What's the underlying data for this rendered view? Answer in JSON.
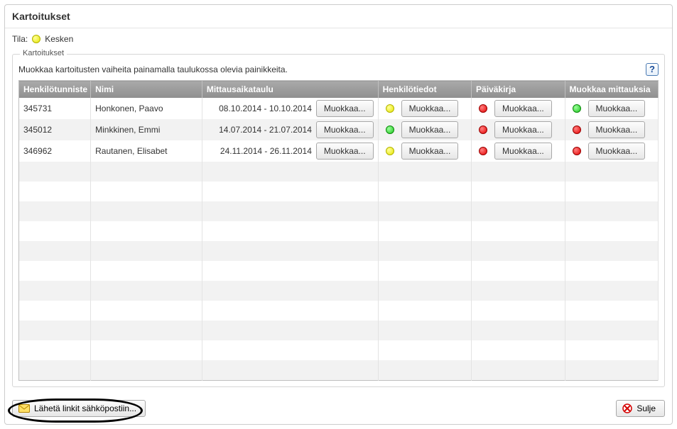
{
  "header": {
    "title": "Kartoitukset"
  },
  "status": {
    "label": "Tila:",
    "value": "Kesken",
    "color": "yellow"
  },
  "fieldset": {
    "legend": "Kartoitukset",
    "instruction": "Muokkaa kartoitusten vaiheita painamalla taulukossa olevia painikkeita."
  },
  "columns": {
    "id": "Henkilötunniste",
    "name": "Nimi",
    "schedule": "Mittausaikataulu",
    "info": "Henkilötiedot",
    "diary": "Päiväkirja",
    "edit": "Muokkaa mittauksia"
  },
  "common": {
    "edit_label": "Muokkaa..."
  },
  "rows": [
    {
      "id": "345731",
      "name": "Honkonen, Paavo",
      "schedule": "08.10.2014 - 10.10.2014",
      "info": "yellow",
      "diary": "red",
      "edit": "green"
    },
    {
      "id": "345012",
      "name": "Minkkinen, Emmi",
      "schedule": "14.07.2014 - 21.07.2014",
      "info": "green",
      "diary": "red",
      "edit": "red"
    },
    {
      "id": "346962",
      "name": "Rautanen, Elisabet",
      "schedule": "24.11.2014 - 26.11.2014",
      "info": "yellow",
      "diary": "red",
      "edit": "red"
    }
  ],
  "empty_rows": 11,
  "footer": {
    "send_links": "Lähetä linkit sähköpostiin...",
    "close": "Sulje"
  }
}
